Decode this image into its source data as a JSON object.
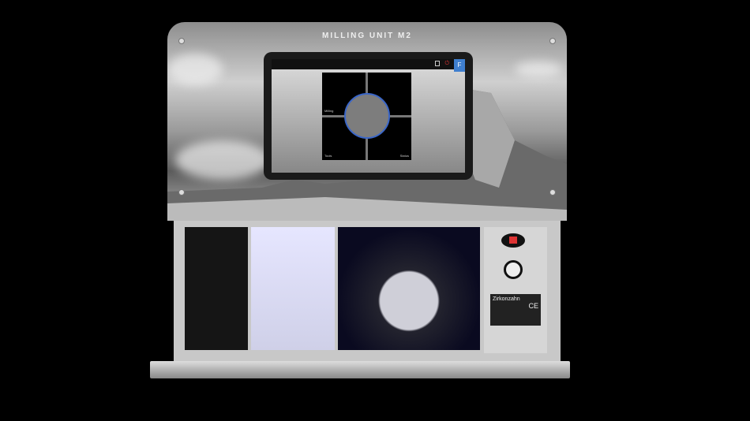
{
  "panel": {
    "title": "MILLING UNIT M2"
  },
  "screen": {
    "tiles": [
      "Milling",
      "",
      "Tools",
      "Status"
    ],
    "button": "F"
  },
  "label_plate": {
    "brand": "Zirkonzahn",
    "mark": "CE"
  }
}
